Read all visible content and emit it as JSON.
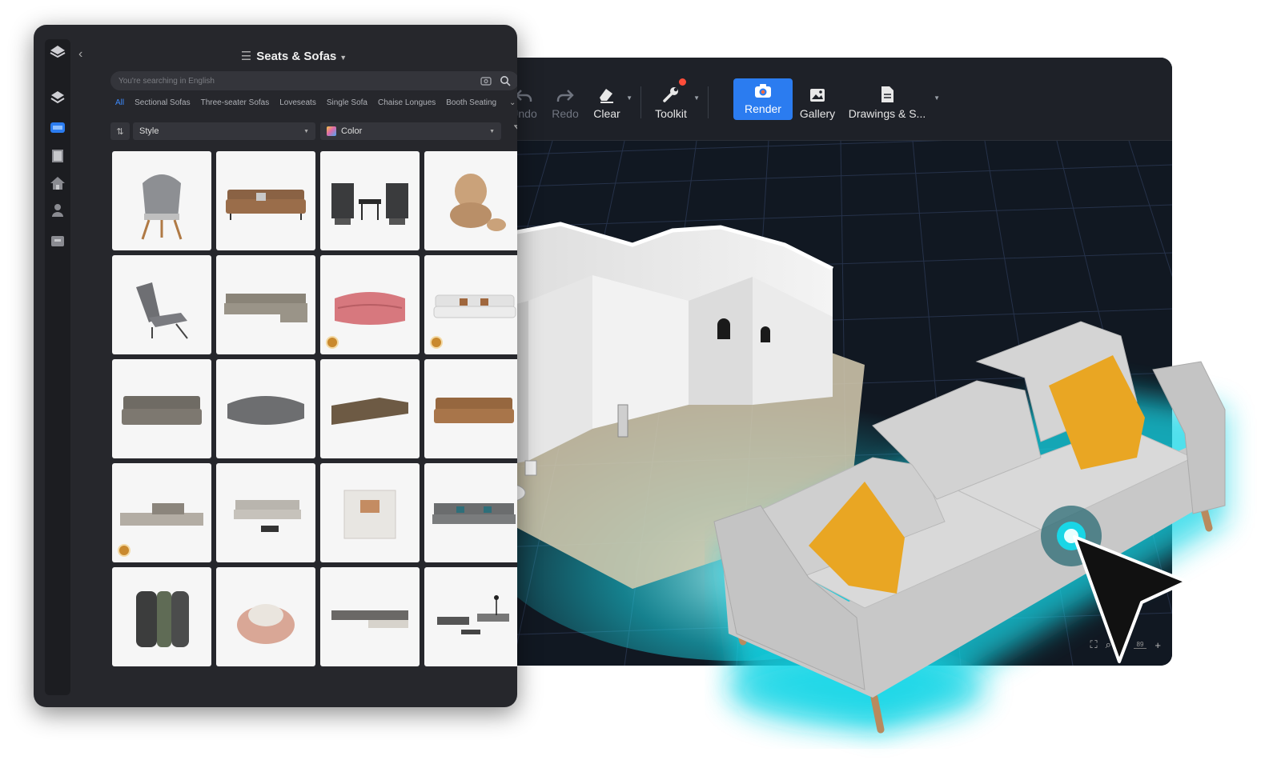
{
  "toolbar": {
    "undo": "Undo",
    "redo": "Redo",
    "clear": "Clear",
    "toolkit": "Toolkit",
    "render": "Render",
    "gallery": "Gallery",
    "drawings": "Drawings & S..."
  },
  "panel": {
    "title": "Seats & Sofas",
    "search_placeholder": "You're searching in English",
    "tabs": [
      "All",
      "Sectional Sofas",
      "Three-seater Sofas",
      "Loveseats",
      "Single Sofa",
      "Chaise Longues",
      "Booth Seating"
    ],
    "active_tab": "All",
    "style_label": "Style",
    "color_label": "Color"
  },
  "zoom": {
    "value": "89"
  },
  "colors": {
    "accent": "#2b7cf0",
    "glow": "#19d6e6",
    "pillow": "#e9a623"
  }
}
